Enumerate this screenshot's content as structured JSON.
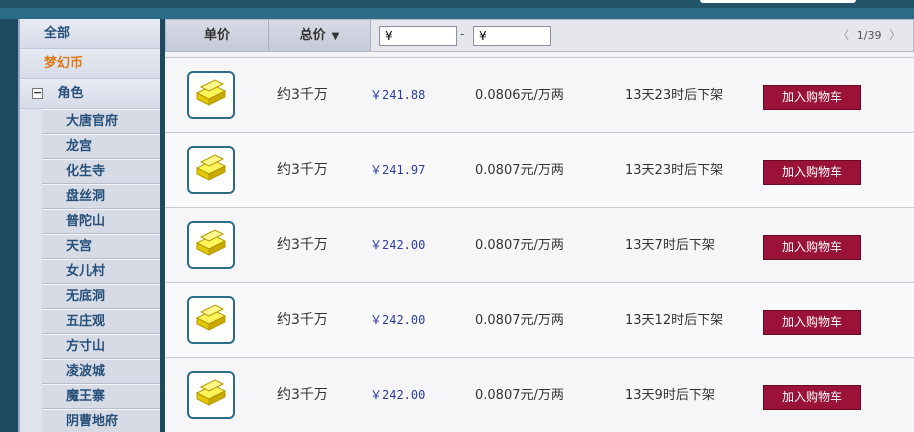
{
  "sidebar": {
    "categories": [
      {
        "label": "全部"
      },
      {
        "label": "梦幻币"
      },
      {
        "label": "角色",
        "toggle": "−"
      }
    ],
    "sub_items": [
      {
        "label": "大唐官府"
      },
      {
        "label": "龙宫"
      },
      {
        "label": "化生寺"
      },
      {
        "label": "盘丝洞"
      },
      {
        "label": "普陀山"
      },
      {
        "label": "天宫"
      },
      {
        "label": "女儿村"
      },
      {
        "label": "无底洞"
      },
      {
        "label": "五庄观"
      },
      {
        "label": "方寸山"
      },
      {
        "label": "凌波城"
      },
      {
        "label": "魔王寨"
      },
      {
        "label": "阴曹地府"
      }
    ]
  },
  "header": {
    "unit_price_label": "单价",
    "total_price_label": "总价",
    "sort_icon": "chevron-down-icon",
    "min_price_value": "¥",
    "max_price_value": "¥",
    "range_dash": "-",
    "pager": {
      "prev": "〈",
      "text": "1/39",
      "next": "〉"
    }
  },
  "listings": [
    {
      "amount": "约3千万",
      "price": "￥241.88",
      "rate": "0.0806元/万两",
      "remaining": "13天23时后下架",
      "button": "加入购物车"
    },
    {
      "amount": "约3千万",
      "price": "￥241.97",
      "rate": "0.0807元/万两",
      "remaining": "13天23时后下架",
      "button": "加入购物车"
    },
    {
      "amount": "约3千万",
      "price": "￥242.00",
      "rate": "0.0807元/万两",
      "remaining": "13天7时后下架",
      "button": "加入购物车"
    },
    {
      "amount": "约3千万",
      "price": "￥242.00",
      "rate": "0.0807元/万两",
      "remaining": "13天12时后下架",
      "button": "加入购物车"
    },
    {
      "amount": "约3千万",
      "price": "￥242.00",
      "rate": "0.0807元/万两",
      "remaining": "13天9时后下架",
      "button": "加入购物车"
    }
  ],
  "colors": {
    "accent_button": "#9a1237",
    "link_blue": "#26507a",
    "price_blue": "#2b3da0",
    "active_category": "#d97a18"
  }
}
